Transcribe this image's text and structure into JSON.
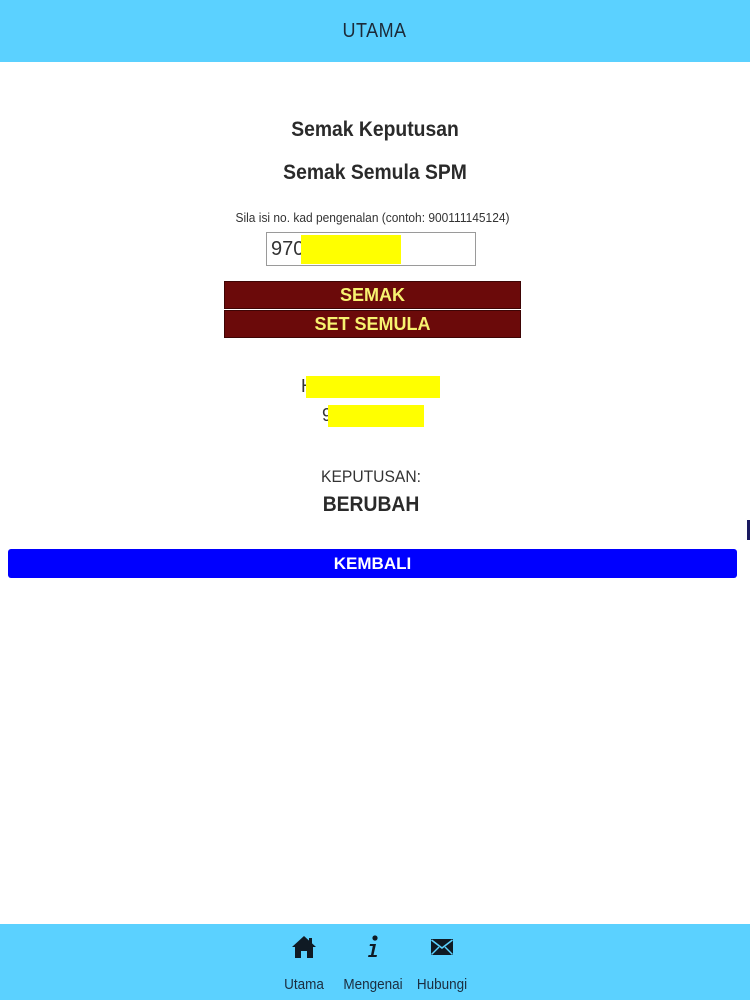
{
  "header": {
    "title": "UTAMA"
  },
  "main": {
    "heading_primary": "Semak Keputusan",
    "heading_secondary": "Semak Semula SPM",
    "instruction": "Sila isi no. kad pengenalan (contoh: 900111145124)",
    "ic_input": {
      "value": "970"
    },
    "check_button_label": "SEMAK",
    "reset_button_label": "SET SEMULA",
    "result": {
      "name_prefix": "H",
      "ic_prefix": "9",
      "label": "KEPUTUSAN:",
      "value": "BERUBAH"
    },
    "back_button_label": "KEMBALI"
  },
  "bottom_nav": {
    "items": [
      {
        "label": "Utama",
        "icon": "home-icon"
      },
      {
        "label": "Mengenai",
        "icon": "info-icon"
      },
      {
        "label": "Hubungi",
        "icon": "envelope-icon"
      }
    ]
  },
  "colors": {
    "bar": "#5bd1ff",
    "dark_button": "#6b0a0a",
    "dark_button_text": "#f7f270",
    "back_button": "#0000ff",
    "redaction": "#ffff00"
  }
}
